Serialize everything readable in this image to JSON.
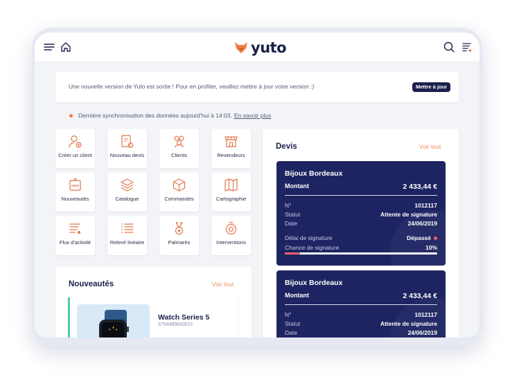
{
  "app": {
    "brand": "yuto"
  },
  "topbar": {
    "menu_icon": "hamburger-menu-icon",
    "home_icon": "home-icon",
    "search_icon": "search-icon",
    "filter_icon": "filter-list-icon"
  },
  "banner": {
    "text": "Une nouvelle version de Yuto est sortie ! Pour en profiter, veuillez mettre à jour votre version :)",
    "button": "Mettre à jour"
  },
  "sync": {
    "text": "Dernière synchronisation des données aujourd'hui à 14:03.",
    "link": "En savoir plus"
  },
  "tiles": [
    {
      "label": "Créer un client",
      "icon": "add-user-icon"
    },
    {
      "label": "Nouveau devis",
      "icon": "new-quote-icon"
    },
    {
      "label": "Clients",
      "icon": "clients-icon"
    },
    {
      "label": "Revendeurs",
      "icon": "store-icon"
    },
    {
      "label": "Nouveautés",
      "icon": "new-tag-icon"
    },
    {
      "label": "Catalogue",
      "icon": "catalog-layers-icon"
    },
    {
      "label": "Commandes",
      "icon": "box-icon"
    },
    {
      "label": "Cartographie",
      "icon": "map-icon"
    },
    {
      "label": "Flux d'activité",
      "icon": "activity-feed-icon"
    },
    {
      "label": "Relevé linéaire",
      "icon": "list-icon"
    },
    {
      "label": "Palmarès",
      "icon": "medal-icon"
    },
    {
      "label": "Interventions",
      "icon": "intervention-icon"
    }
  ],
  "news": {
    "title": "Nouveautés",
    "see_all": "Voir tout",
    "product": {
      "name": "Watch Series 5",
      "ref": "3754489643521"
    }
  },
  "devis": {
    "title": "Devis",
    "see_all": "Voir tout",
    "cards": [
      {
        "client": "Bijoux Bordeaux",
        "amount_label": "Montant",
        "amount": "2 433,44 €",
        "num_label": "N°",
        "num": "1012117",
        "status_label": "Statut",
        "status": "Attente de signature",
        "date_label": "Date",
        "date": "24/06/2019",
        "delay_label": "Délai de signature",
        "delay": "Dépassé",
        "chance_label": "Chance de signature",
        "chance": "10%",
        "chance_value": 0.1
      },
      {
        "client": "Bijoux Bordeaux",
        "amount_label": "Montant",
        "amount": "2 433,44 €",
        "num_label": "N°",
        "num": "1012117",
        "status_label": "Statut",
        "status": "Attente de signature",
        "date_label": "Date",
        "date": "24/06/2019"
      }
    ]
  },
  "colors": {
    "navy": "#1e2461",
    "accent": "#f07a44",
    "teal": "#4ec9b0",
    "danger": "#f2606a"
  }
}
